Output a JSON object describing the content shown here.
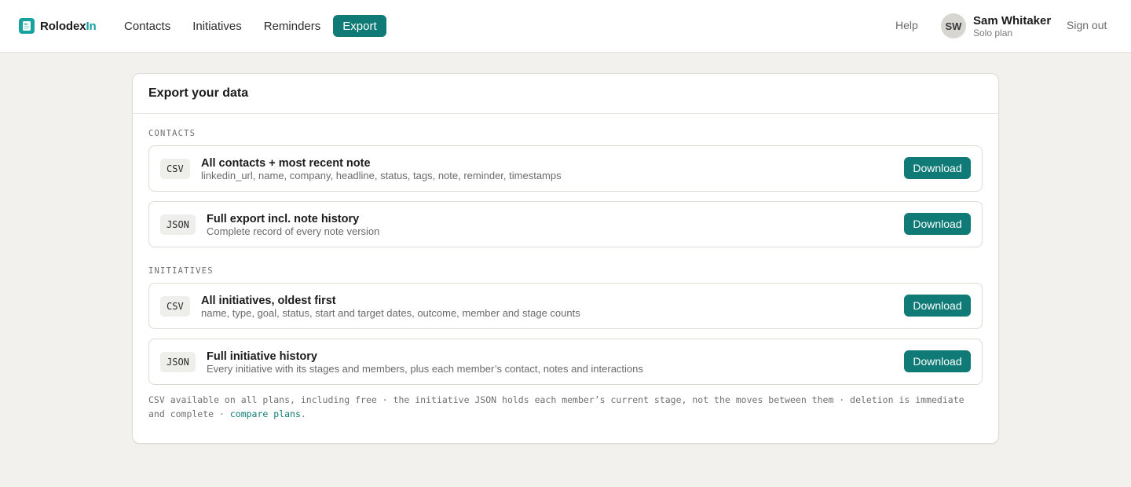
{
  "brand": {
    "name_main": "Rolodex",
    "name_accent": "In",
    "icon": "rolodex-card-icon"
  },
  "nav": {
    "items": [
      {
        "label": "Contacts"
      },
      {
        "label": "Initiatives"
      },
      {
        "label": "Reminders"
      },
      {
        "label": "Export",
        "active": true
      }
    ]
  },
  "header_right": {
    "help": "Help",
    "avatar_initials": "SW",
    "user_name": "Sam Whitaker",
    "plan": "Solo plan",
    "sign_out": "Sign out"
  },
  "card": {
    "title": "Export your data",
    "sections": [
      {
        "label": "CONTACTS",
        "rows": [
          {
            "format": "CSV",
            "title": "All contacts + most recent note",
            "description": "linkedin_url, name, company, headline, status, tags, note, reminder, timestamps",
            "button": "Download"
          },
          {
            "format": "JSON",
            "title": "Full export incl. note history",
            "description": "Complete record of every note version",
            "button": "Download"
          }
        ]
      },
      {
        "label": "INITIATIVES",
        "rows": [
          {
            "format": "CSV",
            "title": "All initiatives, oldest first",
            "description": "name, type, goal, status, start and target dates, outcome, member and stage counts",
            "button": "Download"
          },
          {
            "format": "JSON",
            "title": "Full initiative history",
            "description": "Every initiative with its stages and members, plus each member’s contact, notes and interactions",
            "button": "Download"
          }
        ]
      }
    ],
    "footnote": {
      "text": "CSV available on all plans, including free · the initiative JSON holds each member’s current stage, not the moves between them · deletion is immediate and complete · ",
      "link": "compare plans",
      "end": "."
    }
  },
  "colors": {
    "accent": "#0f7a76",
    "brand_accent": "#14a0a0",
    "background": "#f2f1ed"
  }
}
